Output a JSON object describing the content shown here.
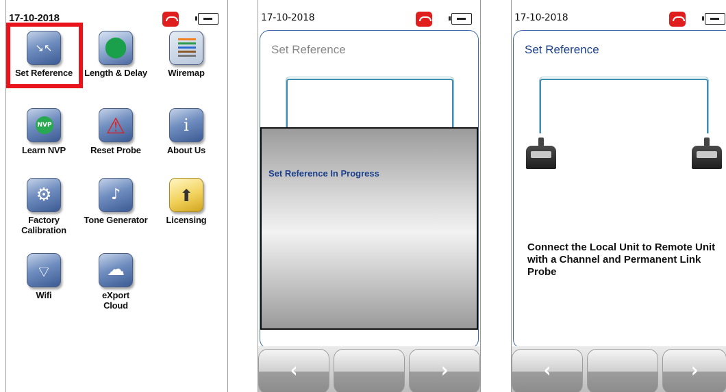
{
  "screens": {
    "menu": {
      "date": "17-10-2018",
      "items": [
        {
          "label": "Set Reference",
          "icon": "set-reference-icon",
          "glyph": "↘↖"
        },
        {
          "label": "Length & Delay",
          "icon": "length-delay-icon",
          "glyph": "⬤"
        },
        {
          "label": "Wiremap",
          "icon": "wiremap-icon",
          "glyph": ""
        },
        {
          "label": "Learn NVP",
          "icon": "learn-nvp-icon",
          "glyph": "NVP"
        },
        {
          "label": "Reset Probe",
          "icon": "reset-probe-icon",
          "glyph": "⚠"
        },
        {
          "label": "About Us",
          "icon": "about-us-icon",
          "glyph": "i"
        },
        {
          "label": "Factory Calibration",
          "icon": "factory-calibration-icon",
          "glyph": "⚙"
        },
        {
          "label": "Tone Generator",
          "icon": "tone-generator-icon",
          "glyph": "♪"
        },
        {
          "label": "Licensing",
          "icon": "licensing-icon",
          "glyph": "⬆"
        },
        {
          "label": "Wifi",
          "icon": "wifi-icon",
          "glyph": "⌔"
        },
        {
          "label": "eXport Cloud",
          "icon": "export-cloud-icon",
          "glyph": "☁"
        }
      ]
    },
    "progress": {
      "date": "17-10-2018",
      "title": "Set Reference",
      "status": "Set Reference In Progress",
      "nav_back": "‹",
      "nav_next": "›"
    },
    "connect": {
      "date": "17-10-2018",
      "title": "Set Reference",
      "instruction": "Connect the Local Unit to Remote Unit with a Channel and Permanent Link Probe",
      "nav_back": "‹",
      "nav_next": "›"
    }
  },
  "colors": {
    "highlight": "#e8131b",
    "title_blue": "#1a3f8a",
    "cable": "#3c8fb0",
    "hangup": "#e01e1e"
  }
}
